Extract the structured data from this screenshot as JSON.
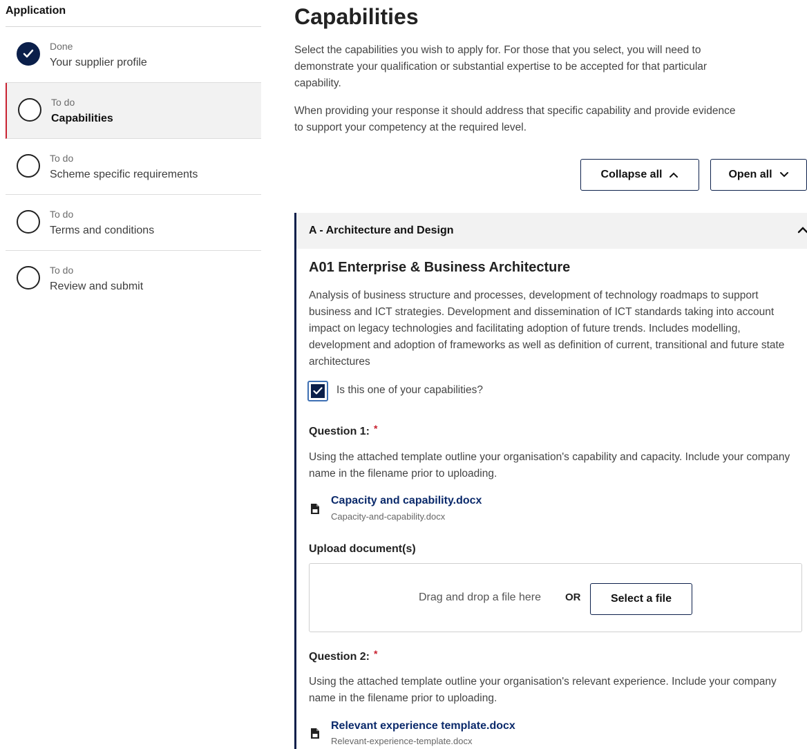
{
  "sidebar": {
    "title": "Application",
    "steps": [
      {
        "status": "Done",
        "label": "Your supplier profile",
        "state": "done"
      },
      {
        "status": "To do",
        "label": "Capabilities",
        "state": "active"
      },
      {
        "status": "To do",
        "label": "Scheme specific requirements",
        "state": "todo"
      },
      {
        "status": "To do",
        "label": "Terms and conditions",
        "state": "todo"
      },
      {
        "status": "To do",
        "label": "Review and submit",
        "state": "todo"
      }
    ]
  },
  "main": {
    "title": "Capabilities",
    "intro_lines_1": [
      "Select the capabilities you wish to apply for. For those that you select, you will need to",
      "demonstrate your qualification or substantial expertise to be accepted for that particular",
      "capability."
    ],
    "intro_lines_2": [
      "When providing your response it should address that specific capability and provide evidence",
      "to support your competency at the required level."
    ],
    "collapse_all": "Collapse all",
    "open_all": "Open all"
  },
  "accordion": {
    "title": "A - Architecture and Design",
    "capability_title": "A01 Enterprise & Business Architecture",
    "description": "Analysis of business structure and processes, development of technology roadmaps to support business and ICT strategies. Development and dissemination of ICT standards taking into account impact on legacy technologies and facilitating adoption of future trends. Includes modelling, development and adoption of frameworks as well as definition of current, transitional and future state architectures",
    "checkbox_label": "Is this one of your capabilities?",
    "checkbox_checked": true,
    "question1": {
      "label": "Question 1:",
      "required_mark": "*",
      "text": "Using the attached template outline your organisation's capability and capacity. Include your company name in the filename prior to uploading.",
      "file_link": "Capacity and capability.docx",
      "file_name": "Capacity-and-capability.docx"
    },
    "upload": {
      "label": "Upload document(s)",
      "drop_text": "Drag and drop a file here",
      "or_text": "OR",
      "select_button": "Select a file"
    },
    "question2": {
      "label": "Question 2:",
      "required_mark": "*",
      "text": "Using the attached template outline your organisation's relevant experience. Include your company name in the filename prior to uploading.",
      "file_link": "Relevant experience template.docx",
      "file_name": "Relevant-experience-template.docx"
    }
  },
  "colors": {
    "navy": "#0b1f4a",
    "active_marker": "#c8202f",
    "required": "#c8202f",
    "link": "#0b2a6b"
  },
  "icons": [
    "check-icon",
    "chevron-up-icon",
    "chevron-down-icon",
    "document-icon"
  ]
}
